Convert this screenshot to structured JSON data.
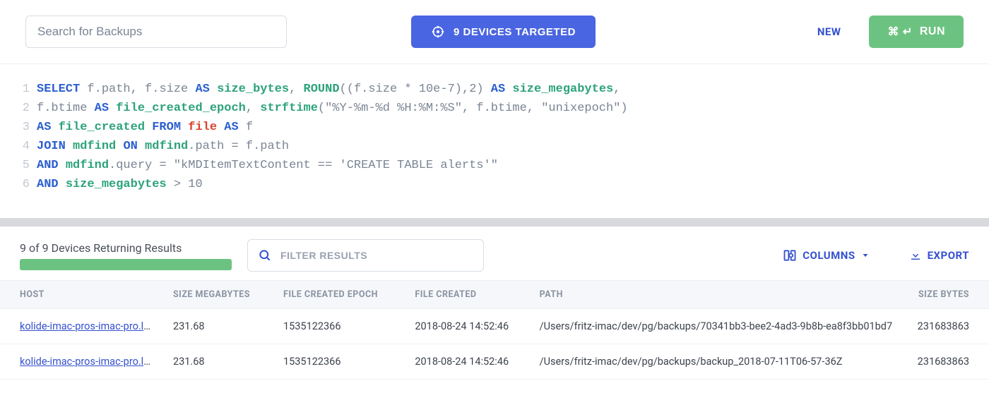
{
  "topbar": {
    "search_placeholder": "Search for Backups",
    "devices_targeted": "9 DEVICES TARGETED",
    "new_label": "NEW",
    "run_shortcut": "⌘ ↵",
    "run_label": "RUN"
  },
  "sql_lines": [
    [
      {
        "t": "SELECT",
        "c": "kw-blue"
      },
      {
        "t": " "
      },
      {
        "t": "f",
        "c": "ident"
      },
      {
        "t": ".",
        "c": "op"
      },
      {
        "t": "path",
        "c": "ident"
      },
      {
        "t": ", ",
        "c": "op"
      },
      {
        "t": "f",
        "c": "ident"
      },
      {
        "t": ".",
        "c": "op"
      },
      {
        "t": "size",
        "c": "ident"
      },
      {
        "t": " "
      },
      {
        "t": "AS",
        "c": "kw-blue"
      },
      {
        "t": " "
      },
      {
        "t": "size_bytes",
        "c": "kw-green"
      },
      {
        "t": ", ",
        "c": "op"
      },
      {
        "t": "ROUND",
        "c": "fn-name"
      },
      {
        "t": "((",
        "c": "op"
      },
      {
        "t": "f",
        "c": "ident"
      },
      {
        "t": ".",
        "c": "op"
      },
      {
        "t": "size",
        "c": "ident"
      },
      {
        "t": " * ",
        "c": "op"
      },
      {
        "t": "10e-7",
        "c": "num"
      },
      {
        "t": "),",
        "c": "op"
      },
      {
        "t": "2",
        "c": "num"
      },
      {
        "t": ") ",
        "c": "op"
      },
      {
        "t": "AS",
        "c": "kw-blue"
      },
      {
        "t": " "
      },
      {
        "t": "size_megabytes",
        "c": "kw-green"
      },
      {
        "t": ",",
        "c": "op"
      }
    ],
    [
      {
        "t": "f",
        "c": "ident"
      },
      {
        "t": ".",
        "c": "op"
      },
      {
        "t": "btime",
        "c": "ident"
      },
      {
        "t": " "
      },
      {
        "t": "AS",
        "c": "kw-blue"
      },
      {
        "t": " "
      },
      {
        "t": "file_created_epoch",
        "c": "kw-green"
      },
      {
        "t": ", ",
        "c": "op"
      },
      {
        "t": "strftime",
        "c": "fn-name"
      },
      {
        "t": "(",
        "c": "op"
      },
      {
        "t": "\"%Y-%m-%d %H:%M:%S\"",
        "c": "str"
      },
      {
        "t": ", ",
        "c": "op"
      },
      {
        "t": "f",
        "c": "ident"
      },
      {
        "t": ".",
        "c": "op"
      },
      {
        "t": "btime",
        "c": "ident"
      },
      {
        "t": ", ",
        "c": "op"
      },
      {
        "t": "\"unixepoch\"",
        "c": "str"
      },
      {
        "t": ")",
        "c": "op"
      }
    ],
    [
      {
        "t": "AS",
        "c": "kw-blue"
      },
      {
        "t": " "
      },
      {
        "t": "file_created",
        "c": "kw-green"
      },
      {
        "t": " "
      },
      {
        "t": "FROM",
        "c": "kw-blue"
      },
      {
        "t": " "
      },
      {
        "t": "file",
        "c": "kw-red"
      },
      {
        "t": " "
      },
      {
        "t": "AS",
        "c": "kw-blue"
      },
      {
        "t": " "
      },
      {
        "t": "f",
        "c": "ident"
      }
    ],
    [
      {
        "t": "JOIN",
        "c": "kw-blue"
      },
      {
        "t": " "
      },
      {
        "t": "mdfind",
        "c": "kw-green"
      },
      {
        "t": " "
      },
      {
        "t": "ON",
        "c": "kw-blue"
      },
      {
        "t": " "
      },
      {
        "t": "mdfind",
        "c": "kw-green"
      },
      {
        "t": ".",
        "c": "op"
      },
      {
        "t": "path",
        "c": "ident"
      },
      {
        "t": " = ",
        "c": "op"
      },
      {
        "t": "f",
        "c": "ident"
      },
      {
        "t": ".",
        "c": "op"
      },
      {
        "t": "path",
        "c": "ident"
      }
    ],
    [
      {
        "t": "AND",
        "c": "kw-blue"
      },
      {
        "t": " "
      },
      {
        "t": "mdfind",
        "c": "kw-green"
      },
      {
        "t": ".",
        "c": "op"
      },
      {
        "t": "query",
        "c": "ident"
      },
      {
        "t": " = ",
        "c": "op"
      },
      {
        "t": "\"kMDItemTextContent == 'CREATE TABLE alerts'\"",
        "c": "str"
      }
    ],
    [
      {
        "t": "AND",
        "c": "kw-blue"
      },
      {
        "t": " "
      },
      {
        "t": "size_megabytes",
        "c": "kw-green"
      },
      {
        "t": " > ",
        "c": "op"
      },
      {
        "t": "10",
        "c": "num"
      }
    ]
  ],
  "results": {
    "status": "9 of 9 Devices Returning Results",
    "filter_placeholder": "FILTER RESULTS",
    "columns_label": "COLUMNS",
    "export_label": "EXPORT",
    "headers": {
      "host": "HOST",
      "size_megabytes": "SIZE MEGABYTES",
      "file_created_epoch": "FILE CREATED EPOCH",
      "file_created": "FILE CREATED",
      "path": "PATH",
      "size_bytes": "SIZE BYTES"
    },
    "rows": [
      {
        "host": "kolide-imac-pros-imac-pro.local",
        "size_megabytes": "231.68",
        "file_created_epoch": "1535122366",
        "file_created": "2018-08-24 14:52:46",
        "path": "/Users/fritz-imac/dev/pg/backups/70341bb3-bee2-4ad3-9b8b-ea8f3bb01bd7",
        "size_bytes": "231683863"
      },
      {
        "host": "kolide-imac-pros-imac-pro.local",
        "size_megabytes": "231.68",
        "file_created_epoch": "1535122366",
        "file_created": "2018-08-24 14:52:46",
        "path": "/Users/fritz-imac/dev/pg/backups/backup_2018-07-11T06-57-36Z",
        "size_bytes": "231683863"
      }
    ]
  }
}
